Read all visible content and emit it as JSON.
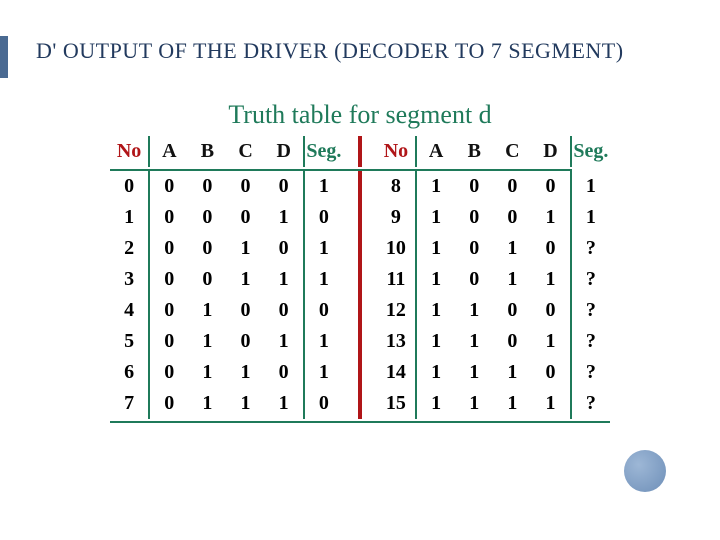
{
  "title_parts": {
    "lead": "D'",
    "rest": " OUTPUT OF THE DRIVER (DECODER TO 7 SEGMENT)"
  },
  "figure_title": "Truth table for segment d",
  "columns": {
    "no": "No",
    "a": "A",
    "b": "B",
    "c": "C",
    "d": "D",
    "seg": "Seg."
  },
  "left_rows": [
    {
      "no": "0",
      "a": "0",
      "b": "0",
      "c": "0",
      "d": "0",
      "seg": "1"
    },
    {
      "no": "1",
      "a": "0",
      "b": "0",
      "c": "0",
      "d": "1",
      "seg": "0"
    },
    {
      "no": "2",
      "a": "0",
      "b": "0",
      "c": "1",
      "d": "0",
      "seg": "1"
    },
    {
      "no": "3",
      "a": "0",
      "b": "0",
      "c": "1",
      "d": "1",
      "seg": "1"
    },
    {
      "no": "4",
      "a": "0",
      "b": "1",
      "c": "0",
      "d": "0",
      "seg": "0"
    },
    {
      "no": "5",
      "a": "0",
      "b": "1",
      "c": "0",
      "d": "1",
      "seg": "1"
    },
    {
      "no": "6",
      "a": "0",
      "b": "1",
      "c": "1",
      "d": "0",
      "seg": "1"
    },
    {
      "no": "7",
      "a": "0",
      "b": "1",
      "c": "1",
      "d": "1",
      "seg": "0"
    }
  ],
  "right_rows": [
    {
      "no": "8",
      "a": "1",
      "b": "0",
      "c": "0",
      "d": "0",
      "seg": "1"
    },
    {
      "no": "9",
      "a": "1",
      "b": "0",
      "c": "0",
      "d": "1",
      "seg": "1"
    },
    {
      "no": "10",
      "a": "1",
      "b": "0",
      "c": "1",
      "d": "0",
      "seg": "?"
    },
    {
      "no": "11",
      "a": "1",
      "b": "0",
      "c": "1",
      "d": "1",
      "seg": "?"
    },
    {
      "no": "12",
      "a": "1",
      "b": "1",
      "c": "0",
      "d": "0",
      "seg": "?"
    },
    {
      "no": "13",
      "a": "1",
      "b": "1",
      "c": "0",
      "d": "1",
      "seg": "?"
    },
    {
      "no": "14",
      "a": "1",
      "b": "1",
      "c": "1",
      "d": "0",
      "seg": "?"
    },
    {
      "no": "15",
      "a": "1",
      "b": "1",
      "c": "1",
      "d": "1",
      "seg": "?"
    }
  ]
}
